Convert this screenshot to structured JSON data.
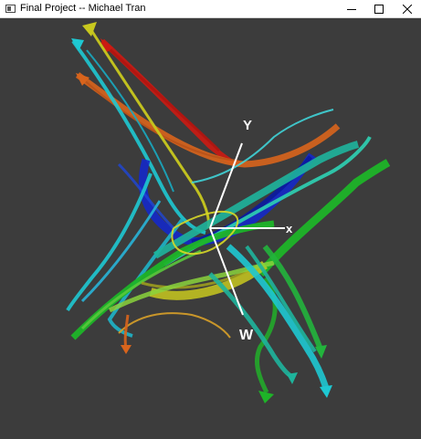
{
  "window": {
    "title": "Final Project -- Michael Tran"
  },
  "icons": {
    "app": "app-window-icon",
    "minimize": "minimize-icon",
    "maximize": "maximize-icon",
    "close": "close-icon"
  },
  "axes": {
    "x_label": "x",
    "y_label": "Y",
    "z_label": "W"
  },
  "colors": {
    "background": "#3c3c3c",
    "axes": "#ffffff",
    "red": "#cc1a12",
    "orange": "#d8641c",
    "yellow": "#c8c81e",
    "cyan": "#1ec8d2",
    "teal": "#1eb49c",
    "blue": "#1428c8",
    "green": "#1eb428",
    "light_green": "#5ac83c"
  }
}
